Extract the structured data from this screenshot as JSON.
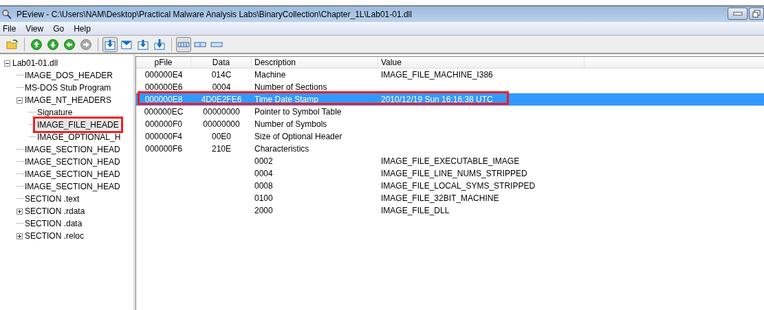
{
  "window": {
    "title": "PEview - C:\\Users\\NAM\\Desktop\\Practical Malware Analysis Labs\\BinaryCollection\\Chapter_1L\\Lab01-01.dll"
  },
  "menu": [
    "File",
    "View",
    "Go",
    "Help"
  ],
  "toolbar": [
    {
      "kind": "open",
      "pressed": false
    },
    {
      "kind": "sep"
    },
    {
      "kind": "up",
      "pressed": false,
      "disabled": false
    },
    {
      "kind": "down",
      "pressed": false,
      "disabled": false
    },
    {
      "kind": "back",
      "pressed": false,
      "disabled": false
    },
    {
      "kind": "forward",
      "pressed": false,
      "disabled": true
    },
    {
      "kind": "sep"
    },
    {
      "kind": "save-box",
      "pressed": true
    },
    {
      "kind": "envelope",
      "pressed": false
    },
    {
      "kind": "save-box",
      "pressed": false
    },
    {
      "kind": "save-arrow",
      "pressed": false
    },
    {
      "kind": "sep"
    },
    {
      "kind": "view-bytes",
      "pressed": true
    },
    {
      "kind": "view-words",
      "pressed": false
    },
    {
      "kind": "view-dwords",
      "pressed": false
    }
  ],
  "tree": [
    {
      "label": "Lab01-01.dll",
      "expanded": true,
      "selected": false,
      "annotated": false,
      "children": [
        {
          "label": "IMAGE_DOS_HEADER",
          "selected": false,
          "annotated": false
        },
        {
          "label": "MS-DOS Stub Program",
          "selected": false,
          "annotated": false
        },
        {
          "label": "IMAGE_NT_HEADERS",
          "expanded": true,
          "selected": false,
          "annotated": false,
          "children": [
            {
              "label": "Signature",
              "selected": false,
              "annotated": false
            },
            {
              "label": "IMAGE_FILE_HEADE",
              "selected": true,
              "annotated": true
            },
            {
              "label": "IMAGE_OPTIONAL_H",
              "selected": false,
              "annotated": false
            }
          ]
        },
        {
          "label": "IMAGE_SECTION_HEAD",
          "selected": false,
          "annotated": false
        },
        {
          "label": "IMAGE_SECTION_HEAD",
          "selected": false,
          "annotated": false
        },
        {
          "label": "IMAGE_SECTION_HEAD",
          "selected": false,
          "annotated": false
        },
        {
          "label": "IMAGE_SECTION_HEAD",
          "selected": false,
          "annotated": false
        },
        {
          "label": "SECTION .text",
          "selected": false,
          "annotated": false
        },
        {
          "label": "SECTION .rdata",
          "expanded": false,
          "selected": false,
          "annotated": false
        },
        {
          "label": "SECTION .data",
          "selected": false,
          "annotated": false
        },
        {
          "label": "SECTION .reloc",
          "expanded": false,
          "selected": false,
          "annotated": false
        }
      ]
    }
  ],
  "table": {
    "columns": [
      "pFile",
      "Data",
      "Description",
      "Value"
    ],
    "rows": [
      {
        "cells": [
          "000000E4",
          "014C",
          "Machine",
          "IMAGE_FILE_MACHINE_I386"
        ],
        "selected": false,
        "annotated": false
      },
      {
        "cells": [
          "000000E6",
          "0004",
          "Number of Sections",
          ""
        ],
        "selected": false,
        "annotated": false
      },
      {
        "cells": [
          "000000E8",
          "4D0E2FE6",
          "Time Date Stamp",
          "2010/12/19 Sun 16:16:38 UTC"
        ],
        "selected": true,
        "annotated": true
      },
      {
        "cells": [
          "000000EC",
          "00000000",
          "Pointer to Symbol Table",
          ""
        ],
        "selected": false,
        "annotated": false
      },
      {
        "cells": [
          "000000F0",
          "00000000",
          "Number of Symbols",
          ""
        ],
        "selected": false,
        "annotated": false
      },
      {
        "cells": [
          "000000F4",
          "00E0",
          "Size of Optional Header",
          ""
        ],
        "selected": false,
        "annotated": false
      },
      {
        "cells": [
          "000000F6",
          "210E",
          "Characteristics",
          ""
        ],
        "selected": false,
        "annotated": false
      },
      {
        "cells": [
          "",
          "",
          "0002",
          "IMAGE_FILE_EXECUTABLE_IMAGE"
        ],
        "selected": false,
        "annotated": false
      },
      {
        "cells": [
          "",
          "",
          "0004",
          "IMAGE_FILE_LINE_NUMS_STRIPPED"
        ],
        "selected": false,
        "annotated": false
      },
      {
        "cells": [
          "",
          "",
          "0008",
          "IMAGE_FILE_LOCAL_SYMS_STRIPPED"
        ],
        "selected": false,
        "annotated": false
      },
      {
        "cells": [
          "",
          "",
          "0100",
          "IMAGE_FILE_32BIT_MACHINE"
        ],
        "selected": false,
        "annotated": false
      },
      {
        "cells": [
          "",
          "",
          "2000",
          "IMAGE_FILE_DLL"
        ],
        "selected": false,
        "annotated": false
      }
    ]
  }
}
